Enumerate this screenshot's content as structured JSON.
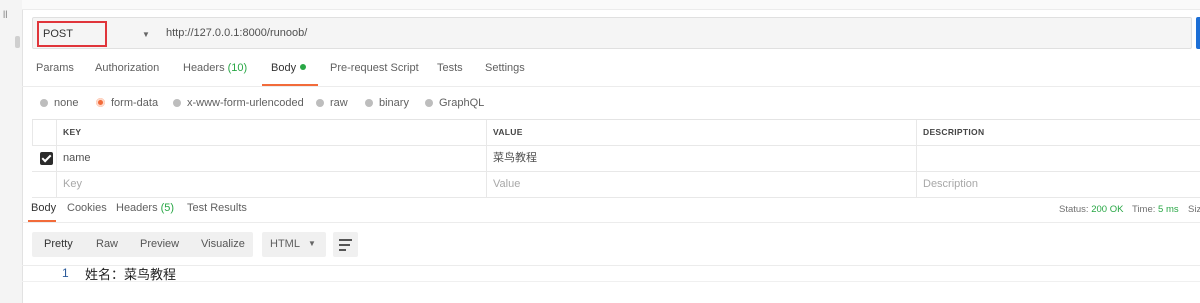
{
  "sidebar": {
    "mark": "ll"
  },
  "request": {
    "method": "POST",
    "url": "http://127.0.0.1:8000/runoob/"
  },
  "request_tabs": [
    {
      "label": "Params"
    },
    {
      "label": "Authorization"
    },
    {
      "label": "Headers",
      "count": "(10)"
    },
    {
      "label": "Body",
      "active": true
    },
    {
      "label": "Pre-request Script"
    },
    {
      "label": "Tests"
    },
    {
      "label": "Settings"
    }
  ],
  "body_modes": [
    {
      "label": "none"
    },
    {
      "label": "form-data",
      "selected": true
    },
    {
      "label": "x-www-form-urlencoded"
    },
    {
      "label": "raw"
    },
    {
      "label": "binary"
    },
    {
      "label": "GraphQL"
    }
  ],
  "form_table": {
    "headers": {
      "key": "KEY",
      "value": "VALUE",
      "description": "DESCRIPTION"
    },
    "rows": [
      {
        "checked": true,
        "key": "name",
        "value": "菜鸟教程",
        "description": ""
      }
    ],
    "placeholders": {
      "key": "Key",
      "value": "Value",
      "description": "Description"
    }
  },
  "response_tabs": [
    {
      "label": "Body",
      "active": true
    },
    {
      "label": "Cookies"
    },
    {
      "label": "Headers",
      "count": "(5)"
    },
    {
      "label": "Test Results"
    }
  ],
  "response_status": {
    "status_label": "Status:",
    "status_value": "200 OK",
    "time_label": "Time:",
    "time_value": "5 ms",
    "size_label": "Siz"
  },
  "view_modes": [
    "Pretty",
    "Raw",
    "Preview",
    "Visualize"
  ],
  "format": "HTML",
  "response_body": {
    "line_number": "1",
    "content": "姓名：菜鸟教程"
  },
  "colors": {
    "accent": "#f26b3a",
    "success": "#28a745",
    "highlight_border": "#e0353b",
    "send": "#1d6fd6"
  }
}
